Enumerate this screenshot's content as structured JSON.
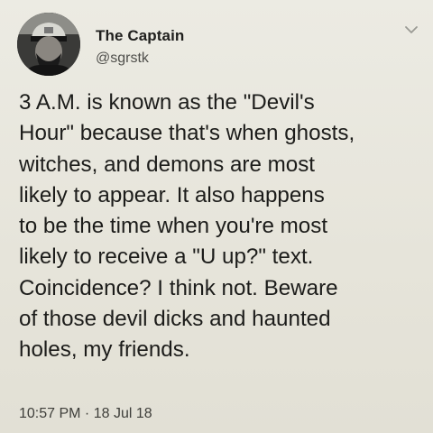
{
  "tweet": {
    "author_name": "The Captain",
    "author_handle": "@sgrstk",
    "text": "3 A.M. is known as the \"Devil's\nHour\" because that's when ghosts,\nwitches, and demons are most\nlikely to appear. It also happens\nto be the time when you're most\nlikely to receive a \"U up?\" text.\nCoincidence? I think not. Beware\nof those devil dicks and haunted\nholes, my friends.",
    "timestamp": "10:57 PM · 18 Jul 18"
  },
  "icons": {
    "avatar": "avatar-photo",
    "menu": "chevron-down-icon"
  },
  "colors": {
    "background": "#e8e6dc",
    "text": "#1c1c1a",
    "secondary_text": "#4f4f4b"
  }
}
